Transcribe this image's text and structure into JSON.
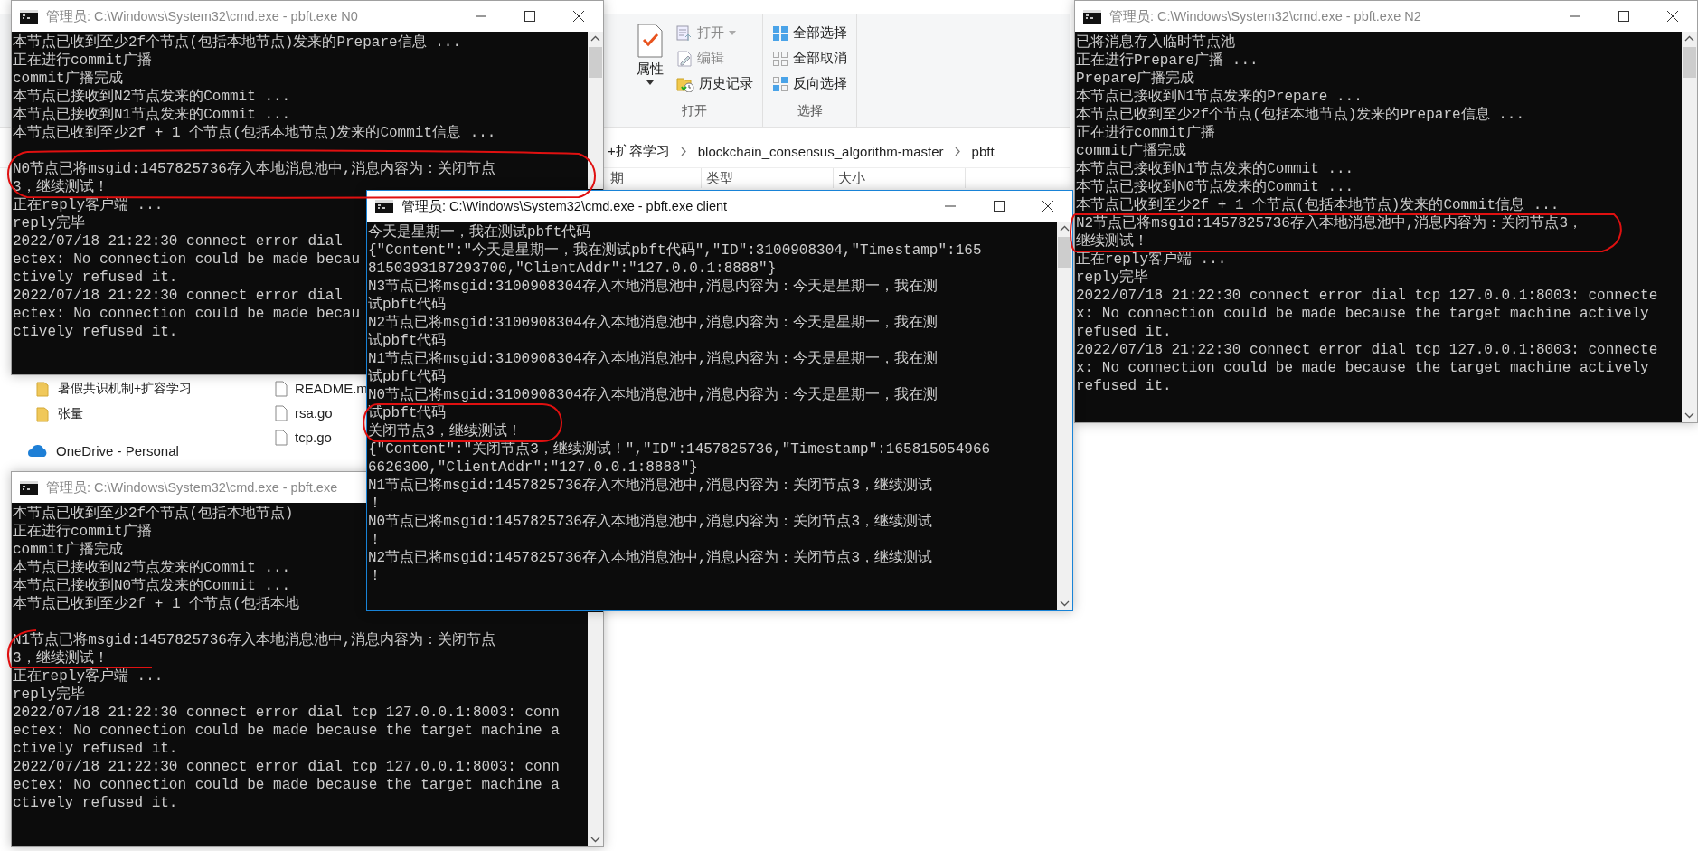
{
  "explorer": {
    "ribbon": [
      {
        "label": "打开",
        "items": [
          {
            "kind": "properties",
            "label": "属性",
            "dropdown": true,
            "disabled": false
          },
          {
            "kind": "open",
            "label": "打开",
            "dropdown": true,
            "disabled": true
          },
          {
            "kind": "edit",
            "label": "编辑",
            "dropdown": false,
            "disabled": true
          },
          {
            "kind": "history",
            "label": "历史记录",
            "dropdown": false,
            "disabled": false
          }
        ]
      },
      {
        "label": "选择",
        "items": [
          {
            "kind": "selectall",
            "label": "全部选择",
            "dropdown": false,
            "disabled": false
          },
          {
            "kind": "selectnone",
            "label": "全部取消",
            "dropdown": false,
            "disabled": false
          },
          {
            "kind": "invert",
            "label": "反向选择",
            "dropdown": false,
            "disabled": false
          }
        ]
      }
    ],
    "breadcrumb": [
      "+扩容学习",
      "blockchain_consensus_algorithm-master",
      "pbft"
    ],
    "columns": [
      "期",
      "类型",
      "大小"
    ],
    "nav_items": [
      {
        "kind": "folder",
        "label": "暑假共识机制+扩容学习"
      },
      {
        "kind": "folder",
        "label": "张量"
      },
      {
        "kind": "cloud",
        "label": "OneDrive - Personal"
      }
    ],
    "files": [
      "README.m",
      "rsa.go",
      "tcp.go"
    ]
  },
  "windows": [
    {
      "title": "管理员: C:\\Windows\\System32\\cmd.exe - pbft.exe  N0",
      "active": false,
      "blocks": [
        [
          "本节点已收到至少2f个节点(包括本地节点)发来的Prepare信息 ...",
          "正在进行commit广播",
          "commit广播完成",
          "本节点已接收到N2节点发来的Commit ...",
          "本节点已接收到N1节点发来的Commit ...",
          "本节点已收到至少2f + 1 个节点(包括本地节点)发来的Commit信息 ..."
        ],
        [
          "N0节点已将msgid:1457825736存入本地消息池中,消息内容为：关闭节点",
          "3，继续测试！",
          "正在reply客户端 ...",
          "reply完毕",
          "2022/07/18 21:22:30 connect error dial",
          "ectex: No connection could be made becau",
          "ctively refused it.",
          "2022/07/18 21:22:30 connect error dial",
          "ectex: No connection could be made becau",
          "ctively refused it."
        ]
      ]
    },
    {
      "title": "管理员: C:\\Windows\\System32\\cmd.exe - pbft.exe  client",
      "active": true,
      "blocks": [
        [
          "今天是星期一，我在测试pbft代码",
          "{\"Content\":\"今天是星期一，我在测试pbft代码\",\"ID\":3100908304,\"Timestamp\":165",
          "8150393187293700,\"ClientAddr\":\"127.0.0.1:8888\"}",
          "N3节点已将msgid:3100908304存入本地消息池中,消息内容为：今天是星期一，我在测",
          "试pbft代码",
          "N2节点已将msgid:3100908304存入本地消息池中,消息内容为：今天是星期一，我在测",
          "试pbft代码",
          "N1节点已将msgid:3100908304存入本地消息池中,消息内容为：今天是星期一，我在测",
          "试pbft代码",
          "N0节点已将msgid:3100908304存入本地消息池中,消息内容为：今天是星期一，我在测",
          "试pbft代码",
          "关闭节点3，继续测试！",
          "{\"Content\":\"关闭节点3，继续测试！\",\"ID\":1457825736,\"Timestamp\":165815054966",
          "6626300,\"ClientAddr\":\"127.0.0.1:8888\"}",
          "N1节点已将msgid:1457825736存入本地消息池中,消息内容为：关闭节点3，继续测试",
          "！",
          "N0节点已将msgid:1457825736存入本地消息池中,消息内容为：关闭节点3，继续测试",
          "！",
          "N2节点已将msgid:1457825736存入本地消息池中,消息内容为：关闭节点3，继续测试",
          "！"
        ]
      ]
    },
    {
      "title": "管理员: C:\\Windows\\System32\\cmd.exe - pbft.exe  N2",
      "active": false,
      "blocks": [
        [
          "已将消息存入临时节点池",
          "正在进行Prepare广播 ...",
          "Prepare广播完成",
          "本节点已接收到N1节点发来的Prepare ...",
          "本节点已收到至少2f个节点(包括本地节点)发来的Prepare信息 ...",
          "正在进行commit广播",
          "commit广播完成",
          "本节点已接收到N1节点发来的Commit ...",
          "本节点已接收到N0节点发来的Commit ...",
          "本节点已收到至少2f + 1 个节点(包括本地节点)发来的Commit信息 ...",
          "N2节点已将msgid:1457825736存入本地消息池中,消息内容为：关闭节点3，",
          "继续测试！",
          "正在reply客户端 ...",
          "reply完毕",
          "2022/07/18 21:22:30 connect error dial tcp 127.0.0.1:8003: connecte",
          "x: No connection could be made because the target machine actively",
          "refused it.",
          "2022/07/18 21:22:30 connect error dial tcp 127.0.0.1:8003: connecte",
          "x: No connection could be made because the target machine actively",
          "refused it."
        ]
      ]
    },
    {
      "title": "管理员: C:\\Windows\\System32\\cmd.exe - pbft.exe",
      "active": false,
      "blocks": [
        [
          "本节点已收到至少2f个节点(包括本地节点)",
          "正在进行commit广播",
          "commit广播完成",
          "本节点已接收到N2节点发来的Commit ...",
          "本节点已接收到N0节点发来的Commit ...",
          "本节点已收到至少2f + 1 个节点(包括本地"
        ],
        [
          "N1节点已将msgid:1457825736存入本地消息池中,消息内容为：关闭节点",
          "3，继续测试！",
          "正在reply客户端 ...",
          "reply完毕",
          "2022/07/18 21:22:30 connect error dial tcp 127.0.0.1:8003: conn",
          "ectex: No connection could be made because the target machine a",
          "ctively refused it.",
          "2022/07/18 21:22:30 connect error dial tcp 127.0.0.1:8003: conn",
          "ectex: No connection could be made because the target machine a",
          "ctively refused it."
        ]
      ]
    }
  ]
}
